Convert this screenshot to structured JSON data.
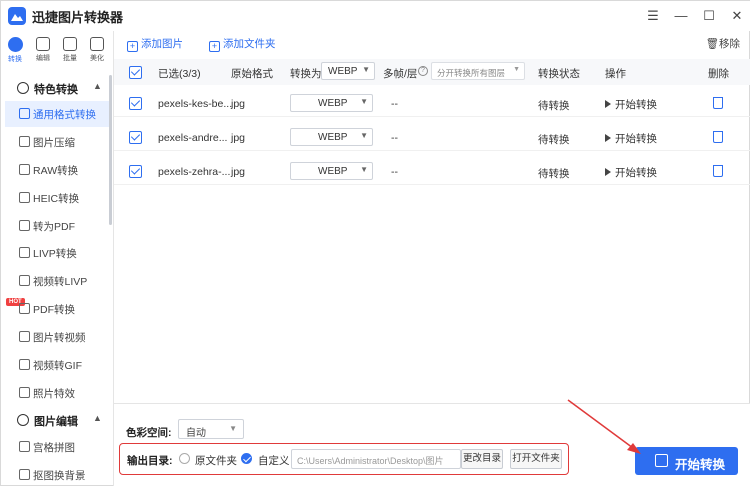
{
  "app": {
    "title": "迅捷图片转换器"
  },
  "window_controls": {
    "menu": "☰",
    "minimize": "—",
    "maximize": "☐",
    "close": "✕"
  },
  "rail": {
    "tabs": [
      {
        "label": "转换",
        "icon": "convert-icon",
        "active": true
      },
      {
        "label": "编辑",
        "icon": "edit-icon",
        "active": false
      },
      {
        "label": "批量",
        "icon": "batch-icon",
        "active": false
      },
      {
        "label": "美化",
        "icon": "beautify-icon",
        "active": false
      }
    ],
    "group1": {
      "title": "特色转换",
      "arrow": "▲"
    },
    "items": [
      {
        "label": "通用格式转换",
        "active": true
      },
      {
        "label": "图片压缩"
      },
      {
        "label": "RAW转换"
      },
      {
        "label": "HEIC转换"
      },
      {
        "label": "转为PDF"
      },
      {
        "label": "LIVP转换"
      },
      {
        "label": "视频转LIVP",
        "badge": "HOT"
      },
      {
        "label": "PDF转换"
      },
      {
        "label": "图片转视频"
      },
      {
        "label": "视频转GIF"
      },
      {
        "label": "照片特效"
      }
    ],
    "group2": {
      "title": "图片编辑",
      "arrow": "▲"
    },
    "items2": [
      {
        "label": "宫格拼图"
      },
      {
        "label": "抠图换背景"
      }
    ]
  },
  "toolbar": {
    "add_image": "添加图片",
    "add_folder": "添加文件夹",
    "remove": "移除"
  },
  "table": {
    "selected": "已选(3/3)",
    "headers": {
      "format": "原始格式",
      "convert_to": "转换为",
      "multi": "多帧/层",
      "status": "转换状态",
      "action": "操作",
      "delete": "删除"
    },
    "header_format_value": "WEBP",
    "multi_placeholder": "分开转换所有图层",
    "rows": [
      {
        "name": "pexels-kes-be...",
        "format": "jpg",
        "target": "WEBP",
        "multi": "--",
        "status": "待转换",
        "action": "开始转换"
      },
      {
        "name": "pexels-andre...",
        "format": "jpg",
        "target": "WEBP",
        "multi": "--",
        "status": "待转换",
        "action": "开始转换"
      },
      {
        "name": "pexels-zehra-...",
        "format": "jpg",
        "target": "WEBP",
        "multi": "--",
        "status": "待转换",
        "action": "开始转换"
      }
    ]
  },
  "bottom": {
    "color_space_label": "色彩空间:",
    "color_space_value": "自动",
    "output_label": "输出目录:",
    "option_original": "原文件夹",
    "option_custom": "自定义",
    "path": "C:\\Users\\Administrator\\Desktop\\图片",
    "change_dir": "更改目录",
    "open_folder": "打开文件夹",
    "start": "开始转换"
  },
  "colors": {
    "accent": "#2e6ef0",
    "highlight_box": "#e03a3a"
  }
}
